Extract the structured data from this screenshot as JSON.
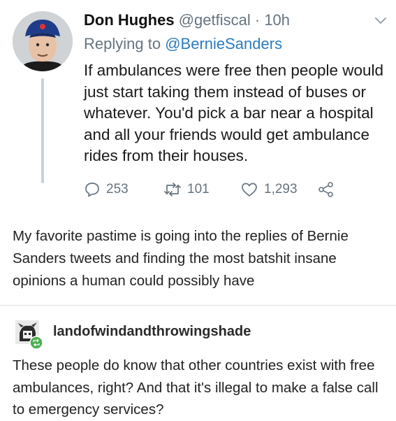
{
  "tweet": {
    "display_name": "Don Hughes",
    "handle": "@getfiscal",
    "separator": "·",
    "time": "10h",
    "replying_prefix": "Replying to",
    "replying_handle": "@BernieSanders",
    "text": "If ambulances were free then people would just start taking them instead of buses or whatever. You'd pick a bar near a hospital and all your friends would get ambulance rides from their houses.",
    "replies": "253",
    "retweets": "101",
    "likes": "1,293"
  },
  "post": {
    "text": "My favorite pastime is going into the replies of Bernie Sanders tweets and finding the most batshit insane opinions a human could possibly have"
  },
  "reblog": {
    "username": "landofwindandthrowingshade",
    "text": "These people do know that other countries exist with free ambulances, right? And that it's illegal to make a false call to emergency services?"
  },
  "colors": {
    "muted": "#66737f",
    "link": "#2b7bbf",
    "thread_line": "#c7d1da",
    "reblog_badge": "#4caf50"
  }
}
